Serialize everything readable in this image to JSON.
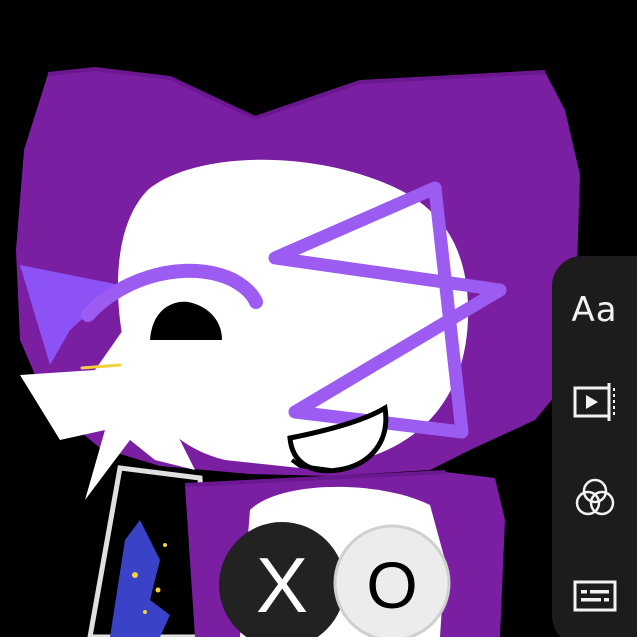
{
  "editor": {
    "toolbar": {
      "text_tool_label": "Aa",
      "tools": [
        {
          "id": "text",
          "icon": "text-aa-icon"
        },
        {
          "id": "trim",
          "icon": "video-trim-icon"
        },
        {
          "id": "filters",
          "icon": "filters-circles-icon"
        },
        {
          "id": "captions",
          "icon": "captions-icon"
        }
      ]
    },
    "stickers": {
      "left_button_symbol": "X",
      "right_button_symbol": "O"
    },
    "colors": {
      "background": "#000000",
      "hood_purple": "#7b1fa2",
      "accent_purple": "#9c5cf2",
      "toolbar_bg": "#1c1c1c",
      "icon_color": "#f2f2f2"
    }
  }
}
